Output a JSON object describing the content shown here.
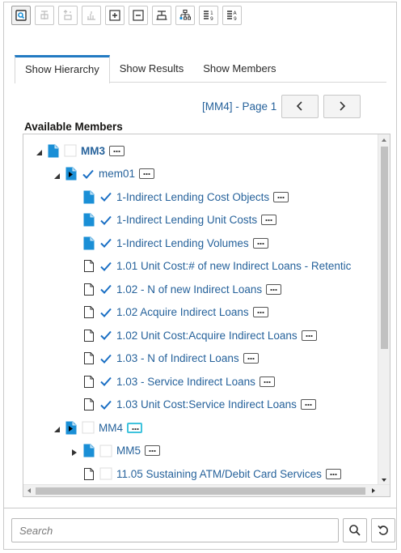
{
  "toolbar": {
    "buttons": [
      {
        "icon": "view-icon",
        "active": true
      },
      {
        "icon": "hierarchy-add-disabled-icon",
        "active": false
      },
      {
        "icon": "hierarchy-up-disabled-icon",
        "active": false
      },
      {
        "icon": "hierarchy-bars-disabled-icon",
        "active": false
      },
      {
        "icon": "expand-all-icon",
        "active": false
      },
      {
        "icon": "collapse-all-icon",
        "active": false
      },
      {
        "icon": "show-hierarchy-tree-icon",
        "active": false
      },
      {
        "icon": "show-levels-tree-icon",
        "active": false
      },
      {
        "icon": "sort-numeric-icon",
        "active": false
      },
      {
        "icon": "sort-alpha-icon",
        "active": false
      }
    ]
  },
  "tabs": [
    {
      "label": "Show Hierarchy",
      "selected": true
    },
    {
      "label": "Show Results",
      "selected": false
    },
    {
      "label": "Show Members",
      "selected": false
    }
  ],
  "pager": {
    "text": "[MM4] - Page 1",
    "prev_symbol": "‹",
    "next_symbol": "›"
  },
  "available_label": "Available Members",
  "tree": [
    {
      "label": "MM3",
      "level": 0,
      "twisty": "expanded",
      "doc": "filled",
      "checked": false,
      "bold": true,
      "more_focus": false
    },
    {
      "label": "mem01",
      "level": 1,
      "twisty": "expanded",
      "doc": "filled-arrow",
      "checked": true,
      "bold": false,
      "more_focus": false
    },
    {
      "label": "1-Indirect Lending Cost Objects",
      "level": 2,
      "twisty": "none",
      "doc": "filled",
      "checked": true,
      "bold": false,
      "more_focus": false
    },
    {
      "label": "1-Indirect Lending Unit Costs",
      "level": 2,
      "twisty": "none",
      "doc": "filled",
      "checked": true,
      "bold": false,
      "more_focus": false
    },
    {
      "label": "1-Indirect Lending Volumes",
      "level": 2,
      "twisty": "none",
      "doc": "filled",
      "checked": true,
      "bold": false,
      "more_focus": false
    },
    {
      "label": "1.01 Unit Cost:# of new Indirect Loans - Retentic",
      "level": 2,
      "twisty": "none",
      "doc": "outline",
      "checked": true,
      "bold": false,
      "more_focus": false,
      "no_more": true
    },
    {
      "label": "1.02 - N of new Indirect Loans",
      "level": 2,
      "twisty": "none",
      "doc": "outline",
      "checked": true,
      "bold": false,
      "more_focus": false
    },
    {
      "label": "1.02 Acquire Indirect Loans",
      "level": 2,
      "twisty": "none",
      "doc": "outline",
      "checked": true,
      "bold": false,
      "more_focus": false
    },
    {
      "label": "1.02 Unit Cost:Acquire Indirect Loans",
      "level": 2,
      "twisty": "none",
      "doc": "outline",
      "checked": true,
      "bold": false,
      "more_focus": false
    },
    {
      "label": "1.03 - N of Indirect Loans",
      "level": 2,
      "twisty": "none",
      "doc": "outline",
      "checked": true,
      "bold": false,
      "more_focus": false
    },
    {
      "label": "1.03 - Service Indirect Loans",
      "level": 2,
      "twisty": "none",
      "doc": "outline",
      "checked": true,
      "bold": false,
      "more_focus": false
    },
    {
      "label": "1.03 Unit Cost:Service Indirect Loans",
      "level": 2,
      "twisty": "none",
      "doc": "outline",
      "checked": true,
      "bold": false,
      "more_focus": false
    },
    {
      "label": "MM4",
      "level": 1,
      "twisty": "expanded",
      "doc": "filled-arrow",
      "checked": false,
      "bold": false,
      "more_focus": true
    },
    {
      "label": "MM5",
      "level": 2,
      "twisty": "collapsed",
      "doc": "filled",
      "checked": false,
      "bold": false,
      "more_focus": false
    },
    {
      "label": "11.05 Sustaining ATM/Debit Card Services",
      "level": 2,
      "twisty": "none",
      "doc": "outline",
      "checked": false,
      "bold": false,
      "more_focus": false
    }
  ],
  "search": {
    "placeholder": "Search",
    "value": ""
  },
  "colors": {
    "accent": "#227ac2",
    "link": "#26629b",
    "focus": "#3fc3dd",
    "doc_fill": "#1a8fd6"
  }
}
